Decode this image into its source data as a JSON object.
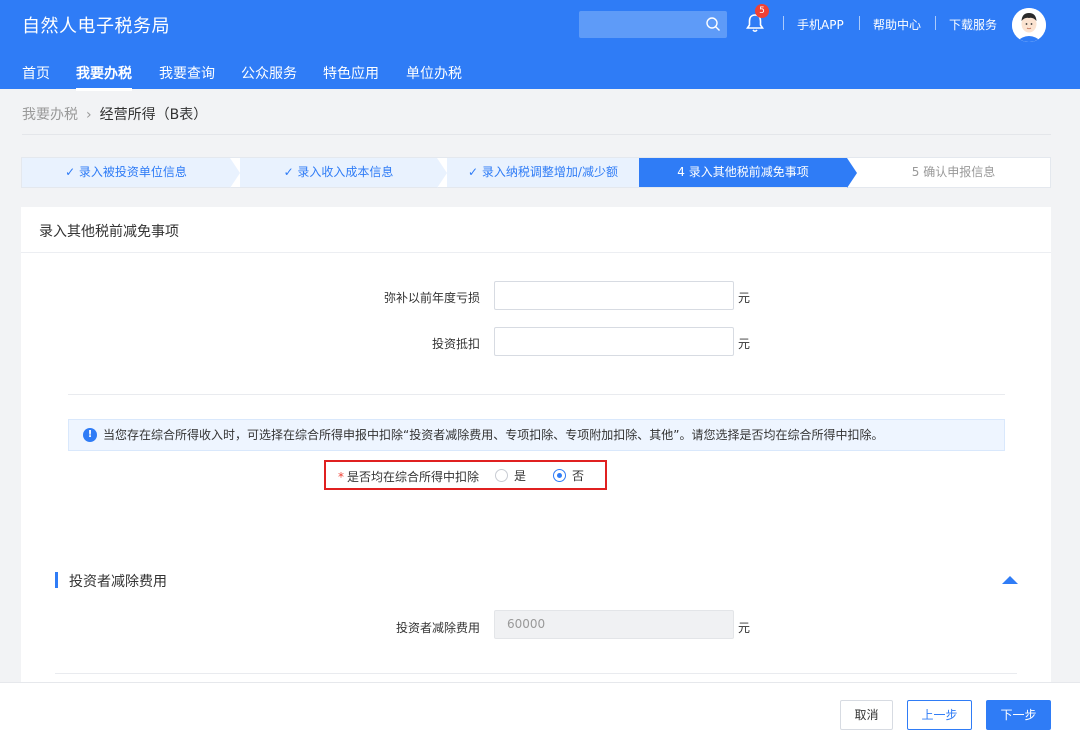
{
  "header": {
    "title": "自然人电子税务局",
    "search": {
      "placeholder": ""
    },
    "notification_count": "5",
    "links": [
      "手机APP",
      "帮助中心",
      "下载服务"
    ]
  },
  "nav": {
    "items": [
      {
        "label": "首页",
        "active": false
      },
      {
        "label": "我要办税",
        "active": true
      },
      {
        "label": "我要查询",
        "active": false
      },
      {
        "label": "公众服务",
        "active": false
      },
      {
        "label": "特色应用",
        "active": false
      },
      {
        "label": "单位办税",
        "active": false
      }
    ]
  },
  "breadcrumb": {
    "parent": "我要办税",
    "separator": "›",
    "current": "经营所得（B表）"
  },
  "steps": [
    {
      "label": "✓ 录入被投资单位信息",
      "status": "done"
    },
    {
      "label": "✓ 录入收入成本信息",
      "status": "done"
    },
    {
      "label": "✓ 录入纳税调整增加/减少额",
      "status": "done"
    },
    {
      "label": "4  录入其他税前减免事项",
      "status": "active"
    },
    {
      "label": "5  确认申报信息",
      "status": "todo"
    }
  ],
  "panel": {
    "title": "录入其他税前减免事项",
    "fields": [
      {
        "label": "弥补以前年度亏损",
        "value": "",
        "unit": "元"
      },
      {
        "label": "投资抵扣",
        "value": "",
        "unit": "元"
      }
    ],
    "notice": "当您存在综合所得收入时，可选择在综合所得申报中扣除“投资者减除费用、专项扣除、专项附加扣除、其他”。请您选择是否均在综合所得中扣除。",
    "question": {
      "required_mark": "*",
      "label": "是否均在综合所得中扣除",
      "options": [
        "是",
        "否"
      ],
      "selected": "否"
    },
    "section": {
      "title": "投资者减除费用",
      "field_label": "投资者减除费用",
      "field_value": "60000",
      "unit": "元"
    }
  },
  "footer": {
    "cancel": "取消",
    "prev": "上一步",
    "next": "下一步"
  },
  "colors": {
    "primary": "#2f7cf6",
    "highlight_border": "#e02020",
    "required": "#f04134"
  }
}
